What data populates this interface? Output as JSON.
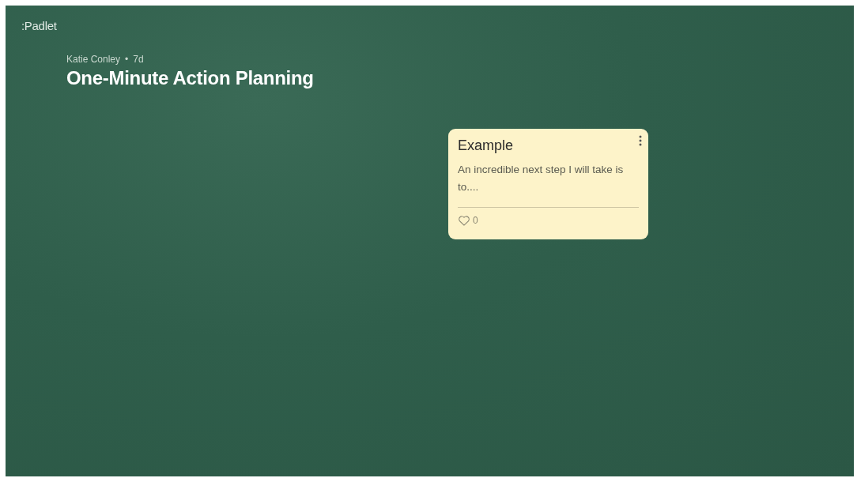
{
  "app": {
    "logo": ":Padlet"
  },
  "header": {
    "author": "Katie Conley",
    "separator": "•",
    "age": "7d",
    "title": "One-Minute Action Planning"
  },
  "posts": [
    {
      "title": "Example",
      "body": "An incredible next step I will take is to....",
      "likes": "0"
    }
  ]
}
